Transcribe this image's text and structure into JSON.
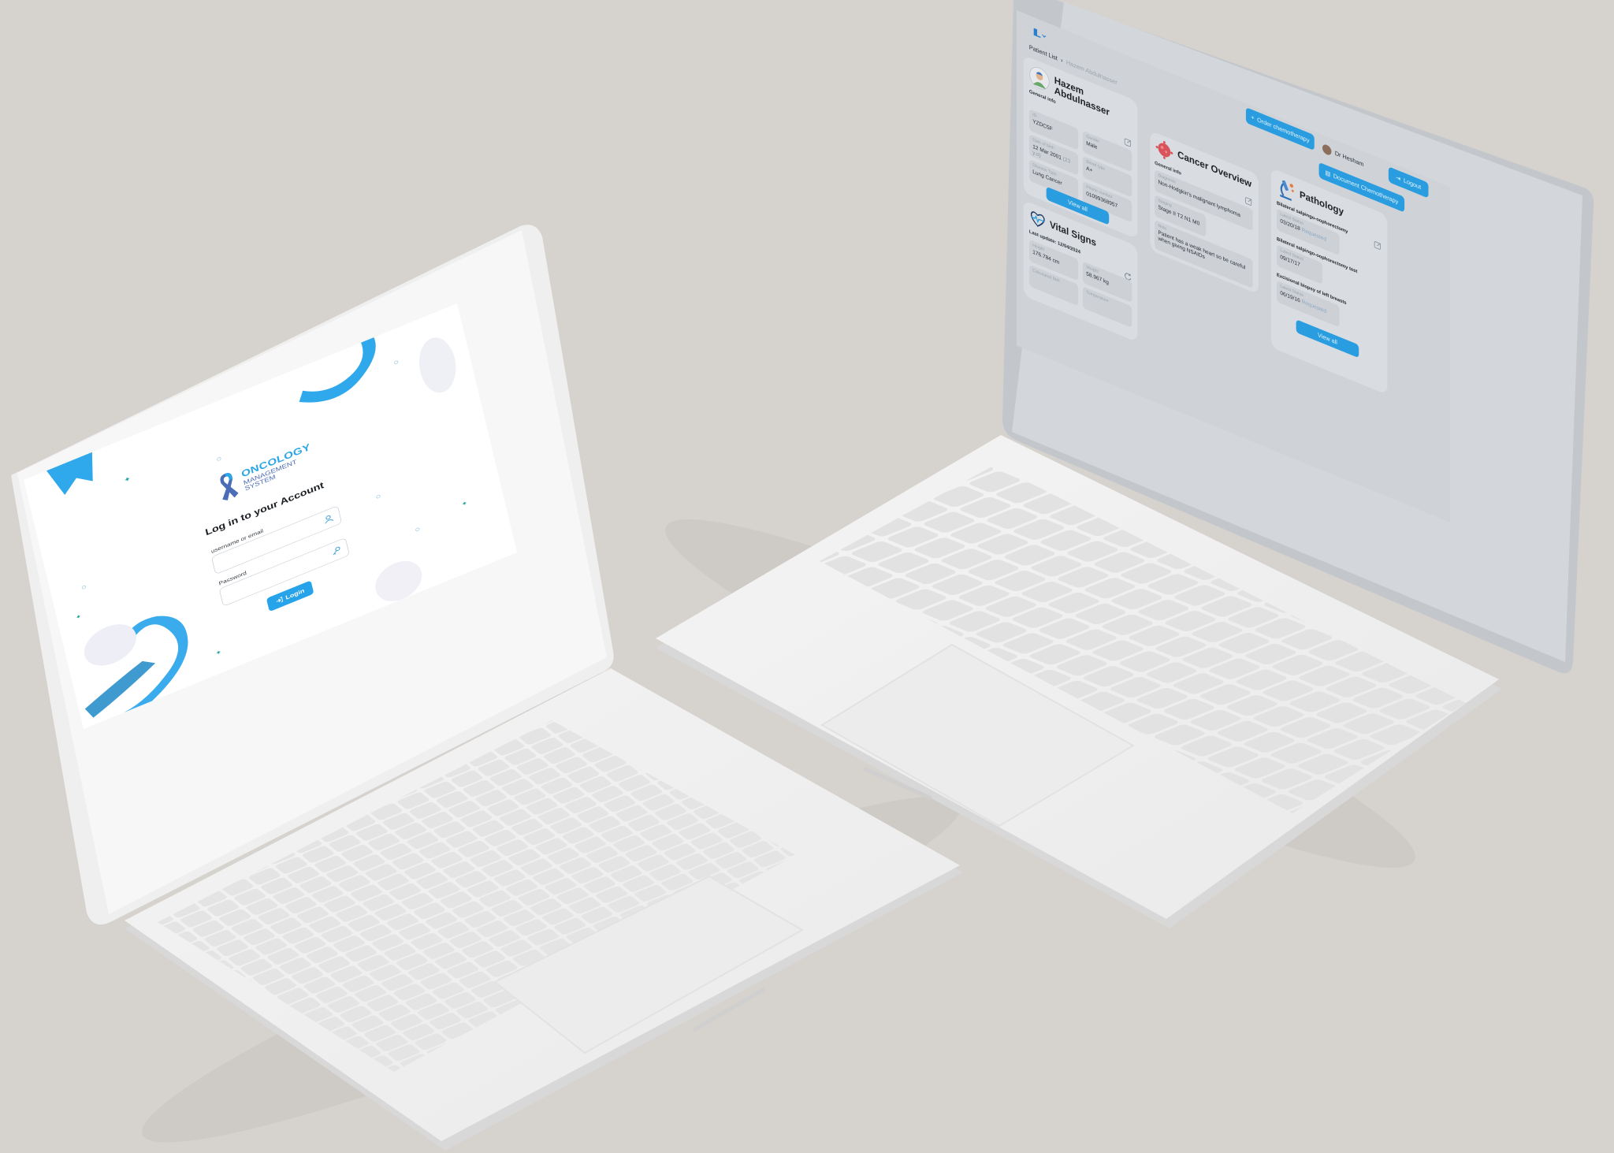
{
  "colors": {
    "background": "#d6d2ce",
    "accent": "#27a3ea",
    "accent_dark": "#2a9de0",
    "logo_secondary": "#4b6cb7"
  },
  "login_screen": {
    "logo": {
      "line1": "ONCOLOGY",
      "line2": "MANAGEMENT",
      "line3": "SYSTEM",
      "icon": "awareness-ribbon-icon"
    },
    "title": "Log in to your Account",
    "username": {
      "label": "username or email",
      "value": "",
      "icon": "user-icon"
    },
    "password": {
      "label": "Password",
      "value": "",
      "icon": "key-icon"
    },
    "login_button": {
      "label": "Login",
      "icon": "login-arrow-icon"
    }
  },
  "dashboard_screen": {
    "breadcrumb": {
      "root": "Patient List",
      "current": "Hazem Abdulnasser"
    },
    "user": {
      "name": "Dr Hesham",
      "icon": "chevron-down-icon"
    },
    "actions": {
      "order_chemo": "Order chemotherapy",
      "logout": "Logout",
      "document_chemo": "Document Chemotherapy"
    },
    "patient_card": {
      "name_line1": "Hazem",
      "name_line2": "Abdulnasser",
      "section": "General info",
      "fields": [
        {
          "label": "ID",
          "value": "YZDC5F"
        },
        {
          "label": "Gender",
          "value": "Male"
        },
        {
          "label": "Date of birth",
          "value": "12 Mar 2001",
          "extra": "(23 y.o)"
        },
        {
          "label": "Blood type",
          "value": "A+"
        },
        {
          "label": "Disease Type",
          "value": "Lung Cancer"
        },
        {
          "label": "Phone number",
          "value": "01099368957"
        }
      ],
      "view_all": "View all"
    },
    "cancer_card": {
      "title": "Cancer Overview",
      "section": "General info",
      "fields": [
        {
          "label": "Diagnosis",
          "value": "Non-Hodgkin's malignant lymphoma"
        },
        {
          "label": "Staging",
          "value": "Stage II T2 N1 M0"
        },
        {
          "label": "Note",
          "value": "Patient has a weak heart so be careful when giving NSAIDs"
        }
      ]
    },
    "pathology_card": {
      "title": "Pathology",
      "items": [
        {
          "title": "Bilateral salpingo-oophorectomy",
          "status_label": "Latest Status",
          "date": "03/20/18",
          "status": "Requested"
        },
        {
          "title": "Bilateral salpingo-oophorectomy test",
          "status_label": "Latest Status",
          "date": "09/17/17",
          "status": ""
        },
        {
          "title": "Excisional biopsy of left breasts",
          "status_label": "Latest Status",
          "date": "06/19/16",
          "status": "Requested"
        }
      ],
      "view_all": "View all"
    },
    "vitals_card": {
      "title": "Vital Signs",
      "last_update": "Last update: 12/04/2024",
      "fields": [
        {
          "label": "Height",
          "value": "176.784 cm"
        },
        {
          "label": "Weight",
          "value": "58.967 kg"
        },
        {
          "label": "Calculated BMI",
          "value": ""
        },
        {
          "label": "Temperature",
          "value": ""
        }
      ]
    }
  }
}
